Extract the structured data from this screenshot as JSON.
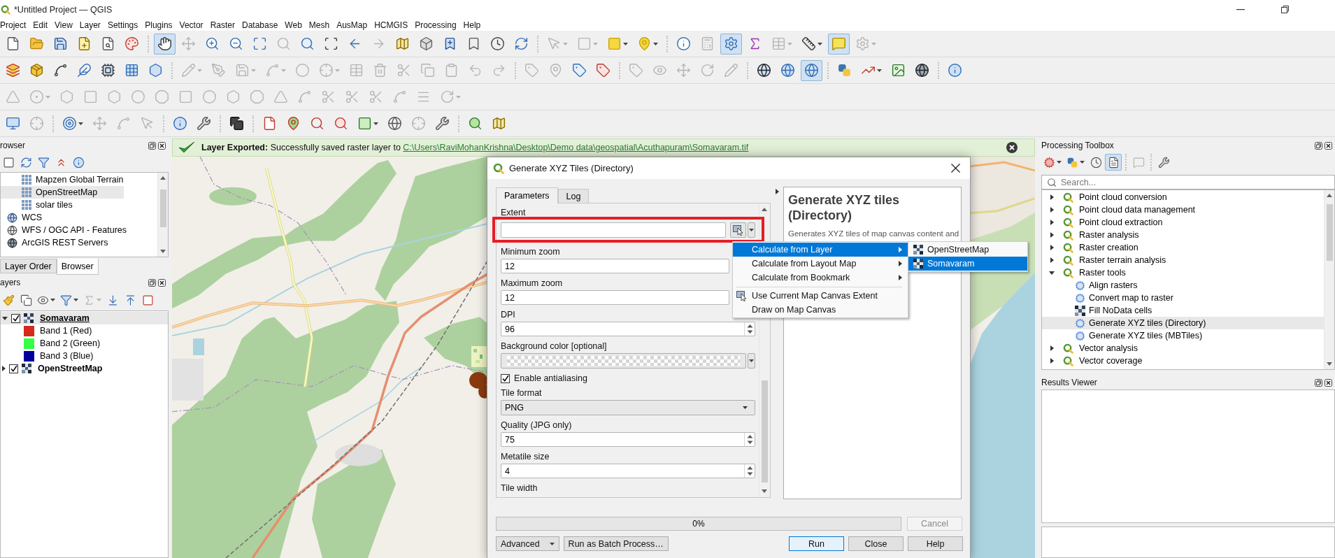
{
  "window": {
    "title": "*Untitled Project — QGIS"
  },
  "menu_bar": [
    "Project",
    "Edit",
    "View",
    "Layer",
    "Settings",
    "Plugins",
    "Vector",
    "Raster",
    "Database",
    "Web",
    "Mesh",
    "AusMap",
    "HCMGIS",
    "Processing",
    "Help"
  ],
  "toolbars": [
    {
      "buttons": [
        {
          "on": false,
          "disabled": false
        },
        {
          "on": false,
          "disabled": false
        },
        {
          "on": false,
          "disabled": false
        },
        {
          "on": false,
          "disabled": false
        },
        {
          "on": false,
          "disabled": false
        },
        {
          "on": false,
          "disabled": false
        },
        {
          "on": true,
          "disabled": false
        },
        {
          "on": false,
          "disabled": true
        },
        {
          "on": false,
          "disabled": false
        },
        {
          "on": false,
          "disabled": false
        },
        {
          "on": false,
          "disabled": false
        },
        {
          "on": false,
          "disabled": true
        },
        {
          "on": false,
          "disabled": false
        },
        {
          "on": false,
          "disabled": false
        },
        {
          "on": false,
          "disabled": false
        },
        {
          "on": false,
          "disabled": true
        },
        {
          "on": false,
          "disabled": false
        },
        {
          "on": false,
          "disabled": false
        },
        {
          "on": false,
          "disabled": false
        },
        {
          "on": false,
          "disabled": false
        },
        {
          "on": false,
          "disabled": false
        },
        {
          "on": false,
          "disabled": false
        },
        {
          "on": false,
          "disabled": true
        },
        {
          "on": false,
          "disabled": true
        },
        {
          "on": false,
          "disabled": false
        },
        {
          "on": false,
          "disabled": false
        },
        {
          "on": false,
          "disabled": false
        },
        {
          "on": false,
          "disabled": true
        },
        {
          "on": true,
          "disabled": false
        },
        {
          "on": false,
          "disabled": false
        },
        {
          "on": false,
          "disabled": true
        },
        {
          "on": false,
          "disabled": false
        },
        {
          "on": true,
          "disabled": false
        },
        {
          "on": false,
          "disabled": true
        }
      ]
    },
    {
      "buttons": [
        {
          "on": false,
          "disabled": false
        },
        {
          "on": false,
          "disabled": false
        },
        {
          "on": false,
          "disabled": false
        },
        {
          "on": false,
          "disabled": false
        },
        {
          "on": false,
          "disabled": false
        },
        {
          "on": false,
          "disabled": false
        },
        {
          "on": false,
          "disabled": false
        },
        {
          "on": false,
          "disabled": true
        },
        {
          "on": false,
          "disabled": true
        },
        {
          "on": false,
          "disabled": true
        },
        {
          "on": false,
          "disabled": true
        },
        {
          "on": false,
          "disabled": true
        },
        {
          "on": false,
          "disabled": true
        },
        {
          "on": false,
          "disabled": true
        },
        {
          "on": false,
          "disabled": true
        },
        {
          "on": false,
          "disabled": true
        },
        {
          "on": false,
          "disabled": true
        },
        {
          "on": false,
          "disabled": true
        },
        {
          "on": false,
          "disabled": true
        },
        {
          "on": false,
          "disabled": true
        },
        {
          "on": false,
          "disabled": true
        },
        {
          "on": false,
          "disabled": true
        },
        {
          "on": false,
          "disabled": false
        },
        {
          "on": false,
          "disabled": false
        },
        {
          "on": false,
          "disabled": true
        },
        {
          "on": false,
          "disabled": true
        },
        {
          "on": false,
          "disabled": true
        },
        {
          "on": false,
          "disabled": true
        },
        {
          "on": false,
          "disabled": true
        },
        {
          "on": false,
          "disabled": false
        },
        {
          "on": false,
          "disabled": false
        },
        {
          "on": true,
          "disabled": false
        },
        {
          "on": false,
          "disabled": false
        },
        {
          "on": false,
          "disabled": false
        },
        {
          "on": false,
          "disabled": false
        },
        {
          "on": false,
          "disabled": false
        },
        {
          "on": false,
          "disabled": false
        }
      ]
    },
    {
      "buttons": [
        {
          "on": false,
          "disabled": true
        },
        {
          "on": false,
          "disabled": true
        },
        {
          "on": false,
          "disabled": true
        },
        {
          "on": false,
          "disabled": true
        },
        {
          "on": false,
          "disabled": true
        },
        {
          "on": false,
          "disabled": true
        },
        {
          "on": false,
          "disabled": true
        },
        {
          "on": false,
          "disabled": true
        },
        {
          "on": false,
          "disabled": true
        },
        {
          "on": false,
          "disabled": true
        },
        {
          "on": false,
          "disabled": true
        },
        {
          "on": false,
          "disabled": true
        },
        {
          "on": false,
          "disabled": true
        },
        {
          "on": false,
          "disabled": true
        },
        {
          "on": false,
          "disabled": true
        },
        {
          "on": false,
          "disabled": true
        },
        {
          "on": false,
          "disabled": true
        },
        {
          "on": false,
          "disabled": true
        },
        {
          "on": false,
          "disabled": true
        }
      ]
    },
    {
      "buttons": [
        {
          "on": false,
          "disabled": false
        },
        {
          "on": false,
          "disabled": true
        },
        {
          "on": false,
          "disabled": false
        },
        {
          "on": false,
          "disabled": true
        },
        {
          "on": false,
          "disabled": true
        },
        {
          "on": false,
          "disabled": true
        },
        {
          "on": false,
          "disabled": false
        },
        {
          "on": false,
          "disabled": false
        },
        {
          "on": false,
          "disabled": false
        },
        {
          "on": false,
          "disabled": false
        },
        {
          "on": false,
          "disabled": false
        },
        {
          "on": false,
          "disabled": false
        },
        {
          "on": false,
          "disabled": false
        },
        {
          "on": false,
          "disabled": false
        },
        {
          "on": false,
          "disabled": false
        },
        {
          "on": false,
          "disabled": true
        },
        {
          "on": false,
          "disabled": false
        },
        {
          "on": false,
          "disabled": false
        },
        {
          "on": false,
          "disabled": false
        }
      ]
    }
  ],
  "browser_panel": {
    "title": "rowser",
    "toolbar": [
      {
        "on": false,
        "disabled": false
      },
      {
        "on": false,
        "disabled": false
      },
      {
        "on": false,
        "disabled": false
      },
      {
        "on": false,
        "disabled": false
      },
      {
        "on": false,
        "disabled": false
      }
    ],
    "items": [
      {
        "label": "Mapzen Global Terrain",
        "kind": "xyz",
        "selected": false
      },
      {
        "label": "OpenStreetMap",
        "kind": "xyz",
        "selected": true
      },
      {
        "label": "solar tiles",
        "kind": "xyz",
        "selected": false
      },
      {
        "label": "WCS",
        "kind": "wcs",
        "selected": false
      },
      {
        "label": "WFS / OGC API - Features",
        "kind": "wfs",
        "selected": false
      },
      {
        "label": "ArcGIS REST Servers",
        "kind": "arcgis",
        "selected": false
      }
    ]
  },
  "dock_tabs": [
    {
      "label": "Layer Order",
      "selected": false
    },
    {
      "label": "Browser",
      "selected": true
    }
  ],
  "layers_panel": {
    "title": "ayers",
    "toolbar": [
      {
        "on": false,
        "disabled": false
      },
      {
        "on": false,
        "disabled": false
      },
      {
        "on": false,
        "disabled": false
      },
      {
        "on": false,
        "disabled": false
      },
      {
        "on": false,
        "disabled": true
      },
      {
        "on": false,
        "disabled": false
      },
      {
        "on": false,
        "disabled": false
      },
      {
        "on": false,
        "disabled": false
      }
    ],
    "layers": [
      {
        "name": "Somavaram",
        "checked": true,
        "expanded": true,
        "selected": true,
        "legend": [
          {
            "label": "Band 1 (Red)",
            "color": "#d42a1c"
          },
          {
            "label": "Band 2 (Green)",
            "color": "#33ff44"
          },
          {
            "label": "Band 3 (Blue)",
            "color": "#00009c"
          }
        ]
      },
      {
        "name": "OpenStreetMap",
        "checked": true,
        "expanded": false,
        "selected": false
      }
    ]
  },
  "message_bar": {
    "title": "Layer Exported:",
    "text": "Successfully saved raster layer to",
    "link": "C:\\Users\\RaviMohanKrishna\\Desktop\\Demo data\\geospatial\\Acuthapuram\\Somavaram.tif"
  },
  "dialog": {
    "title": "Generate XYZ Tiles (Directory)",
    "tabs": [
      {
        "label": "Parameters",
        "selected": true
      },
      {
        "label": "Log",
        "selected": false
      }
    ],
    "parameters": [
      {
        "kind": "extent",
        "label": "Extent"
      },
      {
        "kind": "number",
        "label": "Minimum zoom",
        "value": "12"
      },
      {
        "kind": "number",
        "label": "Maximum zoom",
        "value": "12"
      },
      {
        "kind": "spin",
        "label": "DPI",
        "value": "96"
      },
      {
        "kind": "color",
        "label": "Background color [optional]"
      },
      {
        "kind": "checkbox",
        "label": "Enable antialiasing",
        "checked": true
      },
      {
        "kind": "combo",
        "label": "Tile format",
        "value": "PNG"
      },
      {
        "kind": "spin",
        "label": "Quality (JPG only)",
        "value": "75"
      },
      {
        "kind": "spin",
        "label": "Metatile size",
        "value": "4"
      },
      {
        "kind": "heading",
        "label": "Tile width"
      }
    ],
    "help": {
      "title": "Generate XYZ tiles (Directory)",
      "text": "Generates XYZ tiles of map canvas content and"
    },
    "progress": {
      "level": 0,
      "reading": "0%"
    },
    "cancel_button": {
      "label": "Cancel",
      "disabled": true
    },
    "left_buttons": [
      {
        "label": "Advanced",
        "kind": "menu"
      },
      {
        "label": "Run as Batch Process…",
        "kind": "plain"
      }
    ],
    "right_buttons": [
      {
        "label": "Run",
        "kind": "default"
      },
      {
        "label": "Close",
        "kind": "plain"
      },
      {
        "label": "Help",
        "kind": "plain"
      }
    ],
    "extent_menu": [
      {
        "kind": "submenu",
        "label": "Calculate from Layer",
        "selected": true
      },
      {
        "kind": "submenu",
        "label": "Calculate from Layout Map",
        "selected": false
      },
      {
        "kind": "submenu",
        "label": "Calculate from Bookmark",
        "selected": false
      },
      {
        "kind": "separator"
      },
      {
        "kind": "tool",
        "label": "Use Current Map Canvas Extent",
        "selected": false
      },
      {
        "kind": "action",
        "label": "Draw on Map Canvas",
        "selected": false
      }
    ],
    "layer_submenu": [
      {
        "label": "OpenStreetMap",
        "selected": false
      },
      {
        "label": "Somavaram",
        "selected": true
      }
    ]
  },
  "processing_toolbox": {
    "title": "Processing Toolbox",
    "toolbar": [
      {
        "on": false,
        "disabled": false
      },
      {
        "on": false,
        "disabled": false
      },
      {
        "on": false,
        "disabled": false
      },
      {
        "on": true,
        "disabled": false
      },
      {
        "on": false,
        "disabled": true
      },
      {
        "on": false,
        "disabled": false
      }
    ],
    "search": {
      "placeholder": "Search..."
    },
    "tree": [
      {
        "label": "Point cloud conversion",
        "expanded": false,
        "selected": false
      },
      {
        "label": "Point cloud data management",
        "expanded": false,
        "selected": false
      },
      {
        "label": "Point cloud extraction",
        "expanded": false,
        "selected": false
      },
      {
        "label": "Raster analysis",
        "expanded": false,
        "selected": false
      },
      {
        "label": "Raster creation",
        "expanded": false,
        "selected": false
      },
      {
        "label": "Raster terrain analysis",
        "expanded": false,
        "selected": false
      },
      {
        "label": "Raster tools",
        "expanded": true,
        "selected": false,
        "children": [
          {
            "label": "Align rasters",
            "kind": "algorithm",
            "selected": false
          },
          {
            "label": "Convert map to raster",
            "kind": "algorithm",
            "selected": false
          },
          {
            "label": "Fill NoData cells",
            "kind": "grid",
            "selected": false
          },
          {
            "label": "Generate XYZ tiles (Directory)",
            "kind": "algorithm",
            "selected": true
          },
          {
            "label": "Generate XYZ tiles (MBTiles)",
            "kind": "algorithm",
            "selected": false
          }
        ]
      },
      {
        "label": "Vector analysis",
        "expanded": false,
        "selected": false
      },
      {
        "label": "Vector coverage",
        "expanded": false,
        "selected": false
      }
    ]
  },
  "results_viewer": {
    "title": "Results Viewer"
  }
}
